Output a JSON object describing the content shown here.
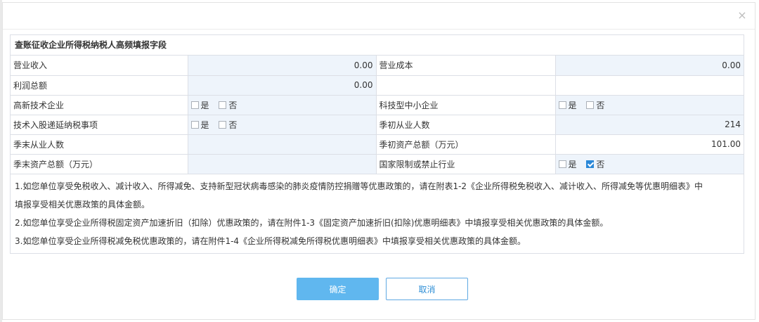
{
  "dialog": {
    "close_glyph": "×",
    "title": "查账征收企业所得税纳税人高频填报字段"
  },
  "rows": {
    "r1": {
      "l1": "营业收入",
      "v1": "0.00",
      "l2": "营业成本",
      "v2": "0.00"
    },
    "r2": {
      "l1": "利润总额",
      "v1": "0.00",
      "l2": "",
      "v2": ""
    },
    "r3": {
      "l1": "高新技术企业",
      "l2": "科技型中小企业"
    },
    "r4": {
      "l1": "技术入股递延纳税事项",
      "l2": "季初从业人数",
      "v2": "214"
    },
    "r5": {
      "l1": "季末从业人数",
      "v1": "",
      "l2": "季初资产总额（万元）",
      "v2": "101.00"
    },
    "r6": {
      "l1": "季末资产总额（万元）",
      "v1": "",
      "l2": "国家限制或禁止行业"
    }
  },
  "options": {
    "yes": "是",
    "no": "否"
  },
  "checkboxes": {
    "high_tech": {
      "yes": false,
      "no": false
    },
    "sci_sme": {
      "yes": false,
      "no": false
    },
    "tech_share": {
      "yes": false,
      "no": false
    },
    "restricted": {
      "yes": false,
      "no": true
    }
  },
  "notes": [
    "1.如您单位享受免税收入、减计收入、所得减免、支持新型冠状病毒感染的肺炎疫情防控捐赠等优惠政策的，请在附表1-2《企业所得税免税收入、减计收入、所得减免等优惠明细表》中",
    "填报享受相关优惠政策的具体金额。",
    "2.如您单位享受企业所得税固定资产加速折旧（扣除）优惠政策的，请在附件1-3《固定资产加速折旧(扣除)优惠明细表》中填报享受相关优惠政策的具体金额。",
    "3.如您单位享受企业所得税减免税优惠政策的，请在附件1-4《企业所得税减免所得税优惠明细表》中填报享受相关优惠政策的具体金额。"
  ],
  "buttons": {
    "confirm": "确定",
    "cancel": "取消"
  },
  "colors": {
    "accent": "#60b7ef",
    "value_text": "#1f8ec9",
    "shaded_cell": "#eef4fb",
    "checked": "#2a88d8"
  }
}
